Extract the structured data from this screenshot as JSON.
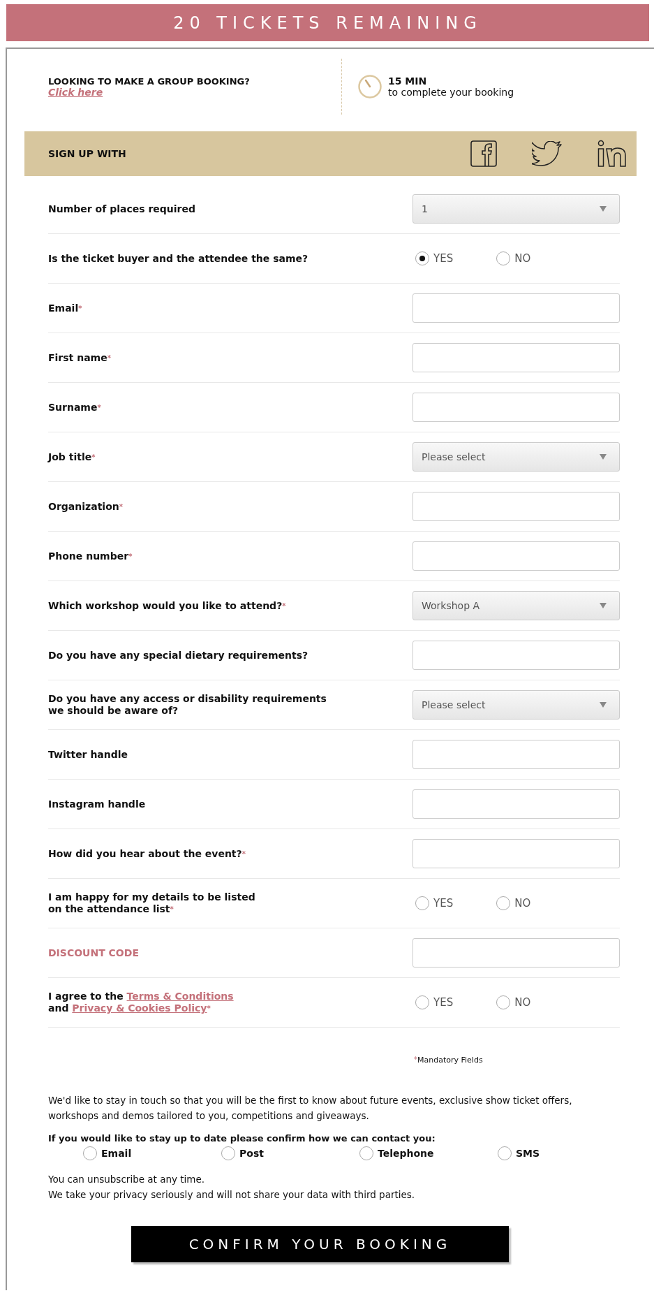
{
  "banner": {
    "title": "20 TICKETS REMAINING"
  },
  "group_booking": {
    "question": "LOOKING TO MAKE A GROUP BOOKING?",
    "link": "Click here"
  },
  "timer": {
    "minutes": "15 MIN",
    "caption": "to complete your booking"
  },
  "sign_up": {
    "label": "SIGN UP WITH"
  },
  "rows": [
    {
      "kind": "select",
      "label": "Number of places required",
      "required": false,
      "accent": false,
      "value": "1"
    },
    {
      "kind": "radio",
      "label": "Is the ticket buyer and the attendee the same?",
      "required": false,
      "accent": false,
      "options": [
        {
          "label": "YES",
          "selected": true
        },
        {
          "label": "NO",
          "selected": false
        }
      ]
    },
    {
      "kind": "input",
      "label": "Email",
      "required": true,
      "accent": false
    },
    {
      "kind": "input",
      "label": "First name",
      "required": true,
      "accent": false
    },
    {
      "kind": "input",
      "label": "Surname",
      "required": true,
      "accent": false
    },
    {
      "kind": "select",
      "label": "Job title",
      "required": true,
      "accent": false,
      "value": "Please select"
    },
    {
      "kind": "input",
      "label": "Organization",
      "required": true,
      "accent": false
    },
    {
      "kind": "input",
      "label": "Phone number",
      "required": true,
      "accent": false
    },
    {
      "kind": "select",
      "label": "Which workshop would you like to attend?",
      "required": true,
      "accent": false,
      "value": "Workshop A"
    },
    {
      "kind": "input",
      "label": "Do you have any special dietary requirements?",
      "required": false,
      "accent": false
    },
    {
      "kind": "select",
      "lines": [
        [
          {
            "text": "Do you have any access or disability requirements"
          }
        ],
        [
          {
            "text": "we should be aware of?"
          }
        ]
      ],
      "required": false,
      "accent": false,
      "value": "Please select"
    },
    {
      "kind": "input",
      "label": "Twitter handle",
      "required": false,
      "accent": false
    },
    {
      "kind": "input",
      "label": "Instagram handle",
      "required": false,
      "accent": false
    },
    {
      "kind": "input",
      "label": "How did you hear about the event?",
      "required": true,
      "accent": false
    },
    {
      "kind": "radio",
      "lines": [
        [
          {
            "text": "I am happy for my details to be listed"
          }
        ],
        [
          {
            "text": "on the attendance list"
          }
        ]
      ],
      "required": true,
      "accent": false,
      "options": [
        {
          "label": "YES",
          "selected": false
        },
        {
          "label": "NO",
          "selected": false
        }
      ]
    },
    {
      "kind": "input",
      "label": "DISCOUNT CODE",
      "required": false,
      "accent": true
    },
    {
      "kind": "radio",
      "lines": [
        [
          {
            "text": "I agree to the "
          },
          {
            "text": "Terms & Conditions",
            "link": true
          }
        ],
        [
          {
            "text": "and "
          },
          {
            "text": "Privacy & Cookies Policy",
            "link": true
          }
        ]
      ],
      "required": true,
      "accent": false,
      "options": [
        {
          "label": "YES",
          "selected": false
        },
        {
          "label": "NO",
          "selected": false
        }
      ]
    }
  ],
  "mandatory_note": {
    "mark": "*",
    "text": "Mandatory Fields"
  },
  "intro": "We'd like to stay in touch so that you will be the first to know about future events, exclusive show ticket offers, workshops and demos tailored to you, competitions and giveaways.",
  "contact": {
    "question": "If you would like to stay up to date please confirm how we can contact you:",
    "options": [
      {
        "label": "Email",
        "checked": false
      },
      {
        "label": "Post",
        "checked": false
      },
      {
        "label": "Telephone",
        "checked": false
      },
      {
        "label": "SMS",
        "checked": false
      }
    ]
  },
  "footer_lines": [
    "You can unsubscribe at any time.",
    "We take your privacy seriously and will not share your data with third parties."
  ],
  "confirm_button": "CONFIRM YOUR BOOKING"
}
